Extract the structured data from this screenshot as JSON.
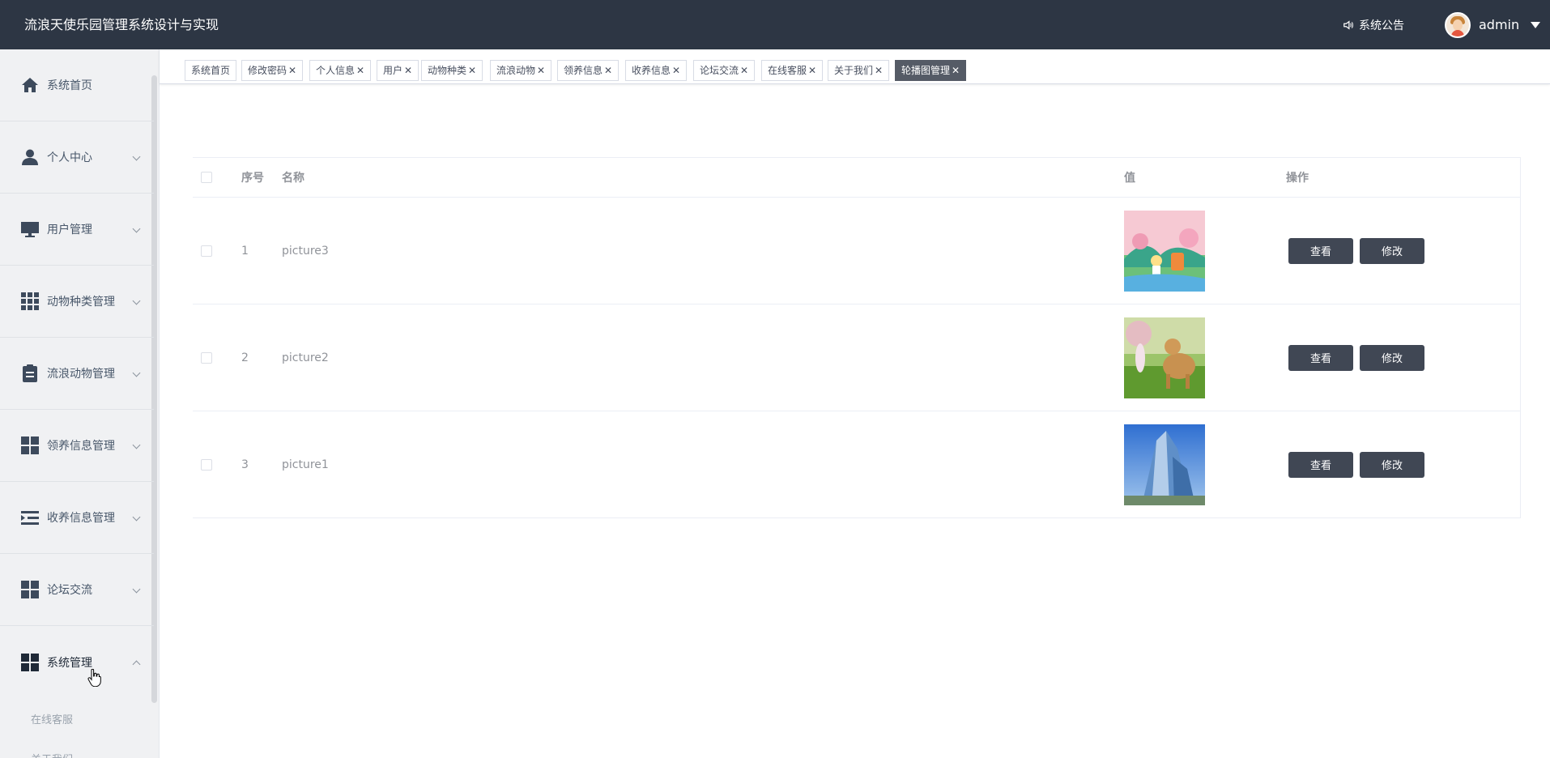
{
  "header": {
    "app_title": "流浪天使乐园管理系统设计与实现",
    "notice_label": "系统公告",
    "username": "admin"
  },
  "sidebar": {
    "items": [
      {
        "label": "系统首页",
        "icon": "home-icon"
      },
      {
        "label": "个人中心",
        "icon": "user-icon"
      },
      {
        "label": "用户管理",
        "icon": "monitor-icon"
      },
      {
        "label": "动物种类管理",
        "icon": "grid-icon"
      },
      {
        "label": "流浪动物管理",
        "icon": "clipboard-icon"
      },
      {
        "label": "领养信息管理",
        "icon": "dashboard-icon"
      },
      {
        "label": "收养信息管理",
        "icon": "list-indent-icon"
      },
      {
        "label": "论坛交流",
        "icon": "dashboard-icon"
      },
      {
        "label": "系统管理",
        "icon": "dashboard-icon"
      }
    ],
    "sub_items": [
      "在线客服",
      "关于我们"
    ]
  },
  "tags": [
    {
      "label": "系统首页",
      "closable": false
    },
    {
      "label": "修改密码",
      "closable": true
    },
    {
      "label": "个人信息",
      "closable": true
    },
    {
      "label": "用户",
      "closable": true
    },
    {
      "label": "动物种类",
      "closable": true
    },
    {
      "label": "流浪动物",
      "closable": true
    },
    {
      "label": "领养信息",
      "closable": true
    },
    {
      "label": "收养信息",
      "closable": true
    },
    {
      "label": "论坛交流",
      "closable": true
    },
    {
      "label": "在线客服",
      "closable": true
    },
    {
      "label": "关于我们",
      "closable": true
    },
    {
      "label": "轮播图管理",
      "closable": true,
      "active": true
    }
  ],
  "table": {
    "headers": {
      "index": "序号",
      "name": "名称",
      "value": "值",
      "actions": "操作"
    },
    "rows": [
      {
        "index": "1",
        "name": "picture3",
        "image": "cartoon-park-scene"
      },
      {
        "index": "2",
        "name": "picture2",
        "image": "dog-and-girl-in-meadow"
      },
      {
        "index": "3",
        "name": "picture1",
        "image": "blue-glass-building"
      }
    ],
    "view_label": "查看",
    "edit_label": "修改"
  },
  "colors": {
    "header_bg": "#2d3644",
    "sidebar_bg": "#f0f1f3",
    "button_bg": "#404754",
    "active_tag_bg": "#555b66"
  }
}
